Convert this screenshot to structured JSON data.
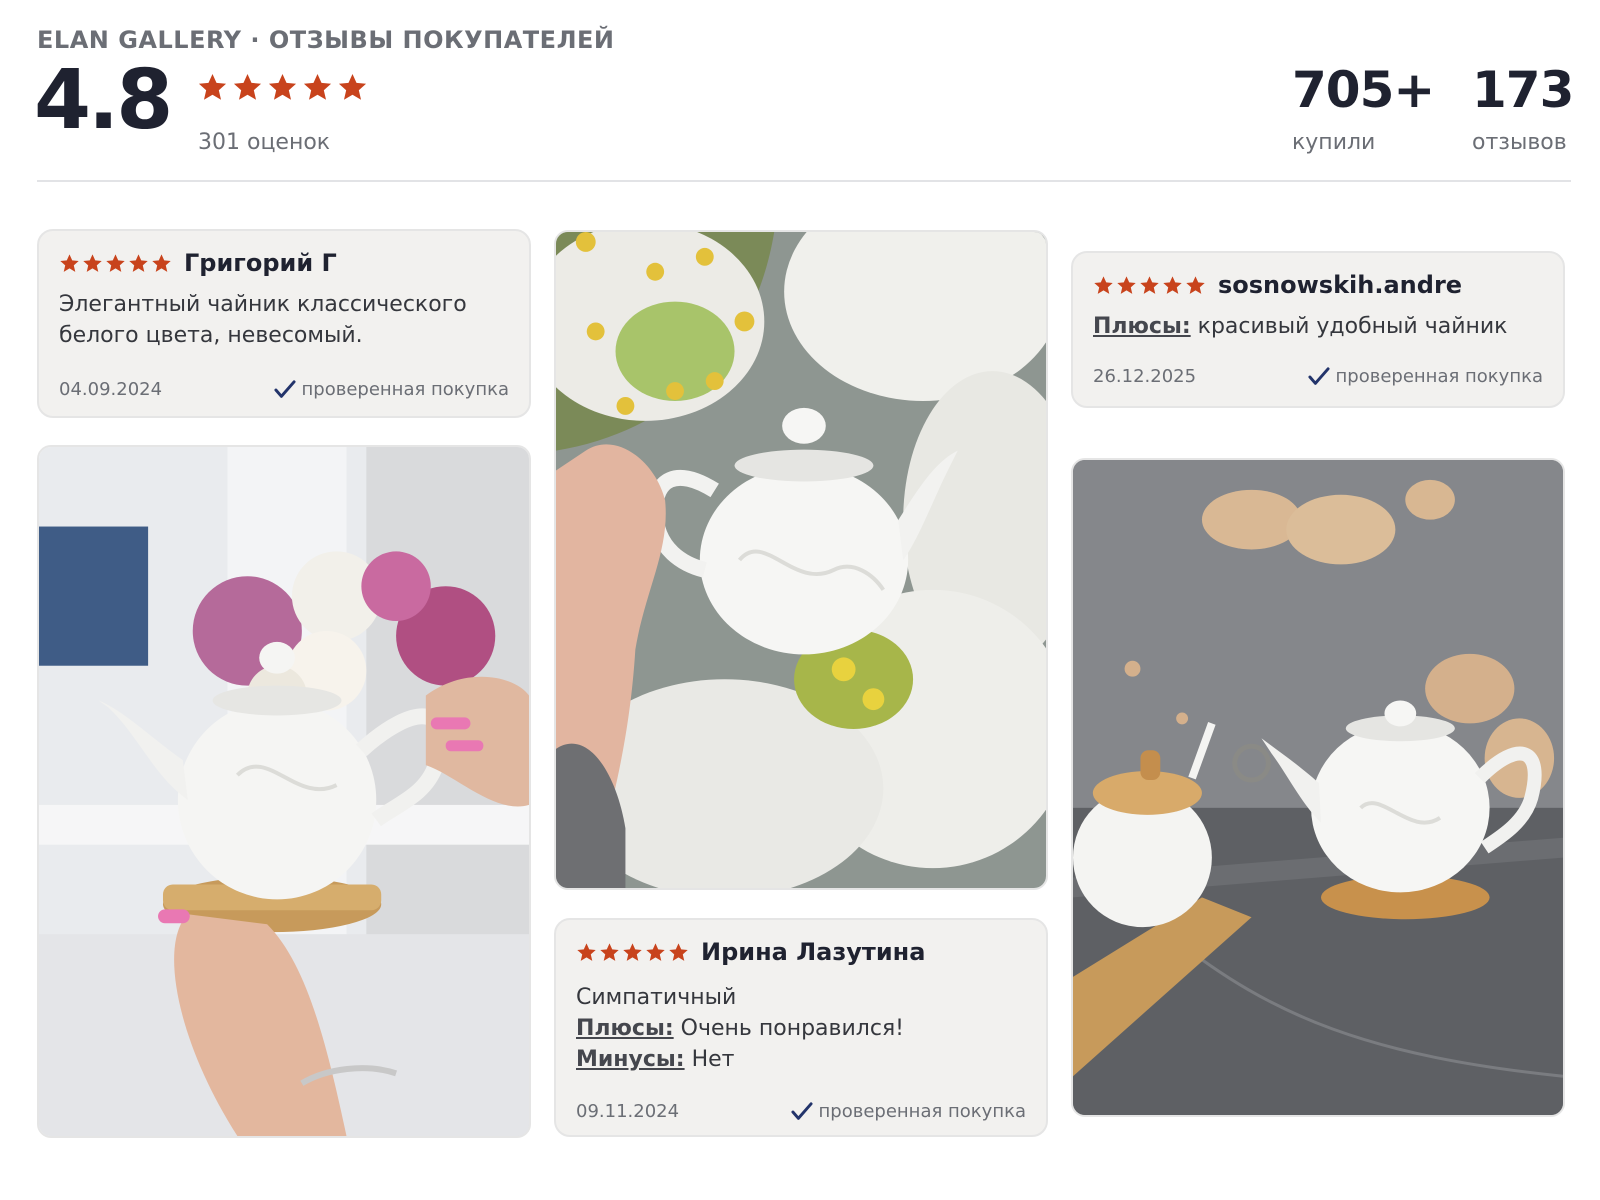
{
  "header": {
    "brand_line": "ELAN GALLERY · ОТЗЫВЫ ПОКУПАТЕЛЕЙ",
    "rating": "4.8",
    "stars": 5,
    "ratings_count": "301 оценок",
    "stats": [
      {
        "value": "705+",
        "label": "купили"
      },
      {
        "value": "173",
        "label": "отзывов"
      }
    ]
  },
  "colors": {
    "star": "#c8431c",
    "check": "#23346b",
    "card_bg": "#f2f1ef"
  },
  "reviews": [
    {
      "author": "Григорий Г",
      "rating": 5,
      "text": "Элегантный чайник классического белого цвета, невесомый.",
      "date": "04.09.2024",
      "verified": "проверенная покупка"
    },
    {
      "author": "sosnowskih.andre",
      "rating": 5,
      "pros_label": "Плюсы:",
      "pros": "красивый удобный чайник",
      "date": "26.12.2025",
      "verified": "проверенная покупка"
    },
    {
      "author": "Ирина Лазутина",
      "rating": 5,
      "text": "Симпатичный",
      "pros_label": "Плюсы:",
      "pros": "Очень понравился!",
      "cons_label": "Минусы:",
      "cons": "Нет",
      "date": "09.11.2024",
      "verified": "проверенная покупка"
    }
  ],
  "photos": [
    {
      "icon": "photo-teapot-hand-flowers"
    },
    {
      "icon": "photo-teapot-white-blossom"
    },
    {
      "icon": "photo-teapot-and-sugar-bowl"
    }
  ]
}
